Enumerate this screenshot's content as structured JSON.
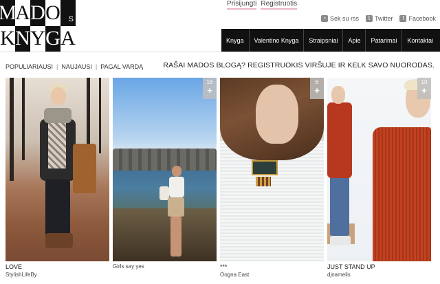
{
  "logo": {
    "row1": [
      "M",
      "A",
      "D",
      "O",
      "S"
    ],
    "row2": [
      "K",
      "N",
      "Y",
      "G",
      "A"
    ]
  },
  "top_links": {
    "login": "Prisijungti",
    "register": "Registruotis"
  },
  "social": [
    {
      "label": "Sek su rss",
      "icon": "rss-icon"
    },
    {
      "label": "Twitter",
      "icon": "twitter-icon"
    },
    {
      "label": "Facebook",
      "icon": "facebook-icon"
    }
  ],
  "nav": [
    "Knyga",
    "Valentino Knyga",
    "Straipsniai",
    "Apie",
    "Patarimai",
    "Kontaktai"
  ],
  "sort": [
    "POPULIARIAUSI",
    "NAUJAUSI",
    "PAGAL VARDĄ"
  ],
  "promo": "RAŠAI MADOS BLOGĄ? REGISTRUOKIS VIRŠUJE IR KELK SAVO NUORODAS.",
  "cards": [
    {
      "count": "",
      "title": "LOVE",
      "user": "StylishLifeBy"
    },
    {
      "count": "16",
      "title": "",
      "user": "Girls say yes"
    },
    {
      "count": "6",
      "title": "***",
      "user": "Oogna East"
    },
    {
      "count": "10",
      "title": "JUST STAND UP",
      "user": "djnamelis"
    }
  ],
  "colors": {
    "nav_bg": "#111111",
    "link_underline": "#e9b3c7"
  }
}
